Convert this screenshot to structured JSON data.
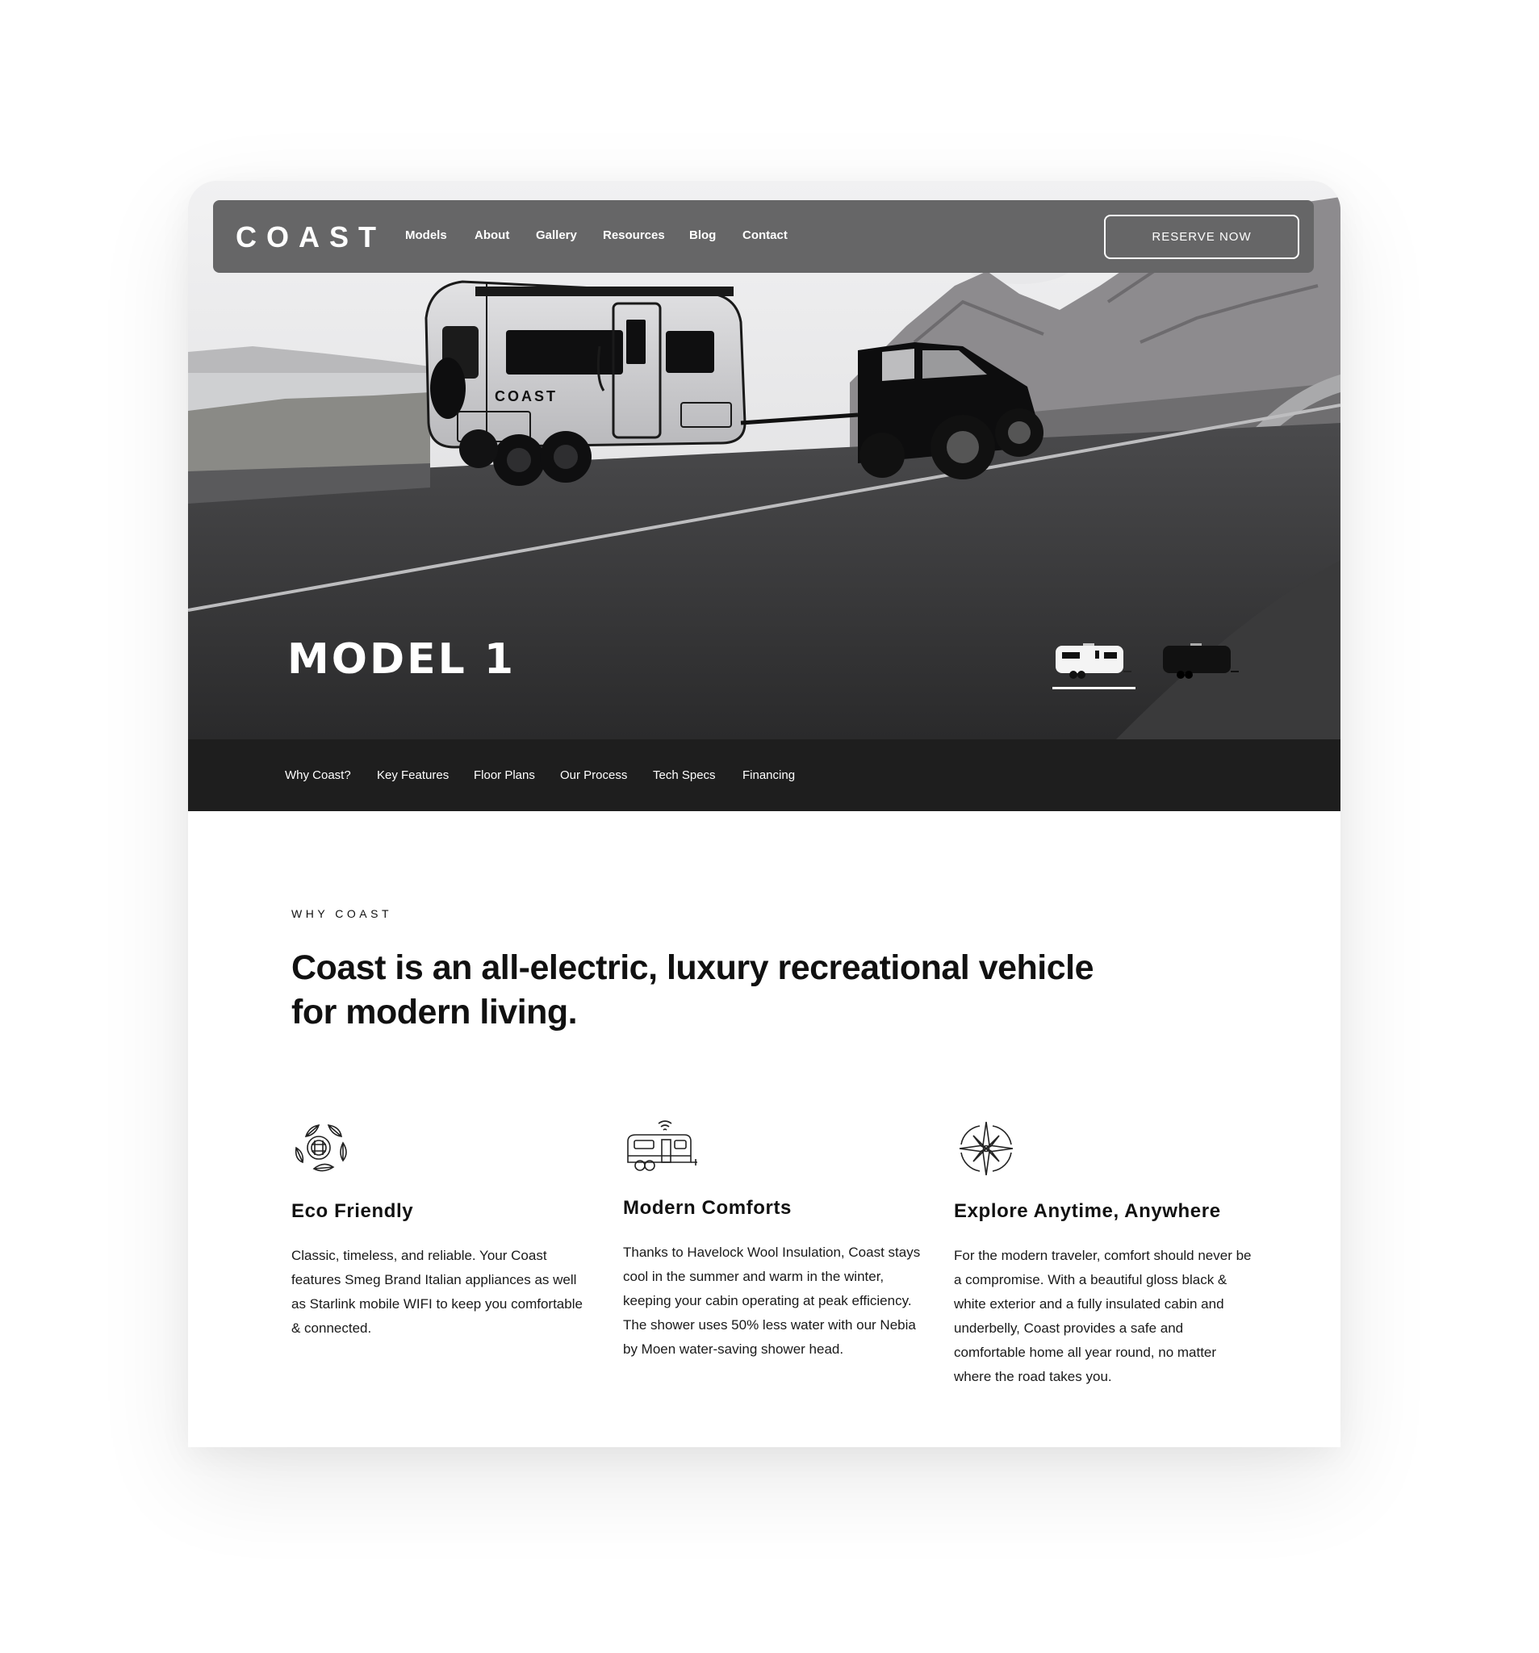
{
  "header": {
    "logo": "COAST",
    "nav": [
      "Models",
      "About",
      "Gallery",
      "Resources",
      "Blog",
      "Contact"
    ],
    "cta_label": "RESERVE NOW"
  },
  "hero": {
    "title": "MODEL 1",
    "image_description": "White Coast travel trailer towed by black pickup truck on a coastal mountain road",
    "trailer_badge": "COAST",
    "variants": [
      {
        "name": "white-trailer",
        "active": true
      },
      {
        "name": "black-trailer",
        "active": false
      }
    ]
  },
  "subnav": [
    "Why Coast?",
    "Key Features",
    "Floor Plans",
    "Our Process",
    "Tech Specs",
    "Financing"
  ],
  "why": {
    "eyebrow": "WHY COAST",
    "headline": "Coast is an all-electric, luxury recreational vehicle for modern living."
  },
  "features": [
    {
      "icon": "eco-globe-leaves-icon",
      "title": "Eco Friendly",
      "body": "Classic, timeless, and reliable. Your Coast features Smeg Brand Italian appliances as well as Starlink mobile WIFI to keep you comfortable & connected."
    },
    {
      "icon": "trailer-wifi-icon",
      "title": "Modern Comforts",
      "body": "Thanks to Havelock Wool Insulation, Coast stays cool in the summer and warm in the winter, keeping your cabin operating at peak efficiency. The shower uses 50% less water with our Nebia by Moen water-saving shower head."
    },
    {
      "icon": "compass-rose-icon",
      "title": "Explore Anytime, Anywhere",
      "body": "For the modern traveler, comfort should never be a compromise. With a beautiful gloss black & white exterior and a fully insulated cabin and underbelly, Coast provides a safe and comfortable home all year round, no matter where the road takes you."
    }
  ],
  "colors": {
    "nav_bg": "#666667",
    "subnav_bg": "#1e1e1e",
    "text": "#111111",
    "white": "#ffffff"
  }
}
